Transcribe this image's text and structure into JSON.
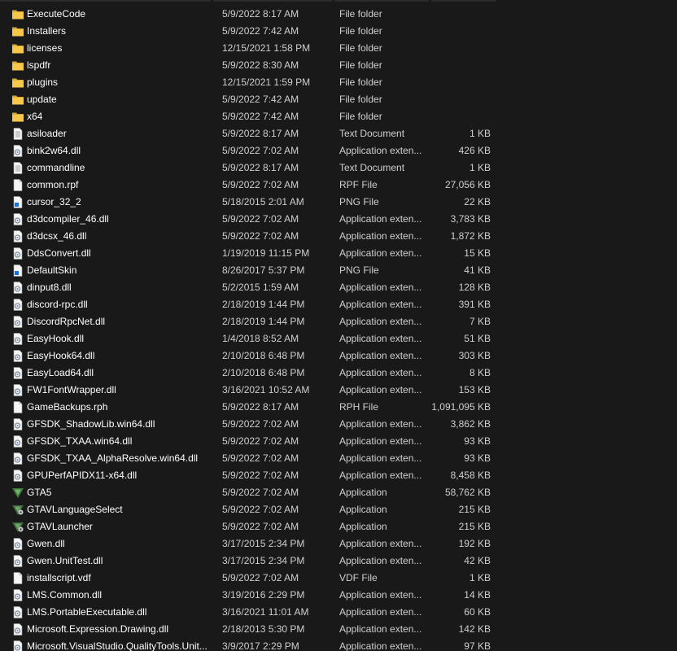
{
  "files": [
    {
      "name": "ExecuteCode",
      "date": "5/9/2022 8:17 AM",
      "type": "File folder",
      "size": "",
      "icon": "folder-icon"
    },
    {
      "name": "Installers",
      "date": "5/9/2022 7:42 AM",
      "type": "File folder",
      "size": "",
      "icon": "folder-icon"
    },
    {
      "name": "licenses",
      "date": "12/15/2021 1:58 PM",
      "type": "File folder",
      "size": "",
      "icon": "folder-icon"
    },
    {
      "name": "lspdfr",
      "date": "5/9/2022 8:30 AM",
      "type": "File folder",
      "size": "",
      "icon": "folder-icon"
    },
    {
      "name": "plugins",
      "date": "12/15/2021 1:59 PM",
      "type": "File folder",
      "size": "",
      "icon": "folder-icon"
    },
    {
      "name": "update",
      "date": "5/9/2022 7:42 AM",
      "type": "File folder",
      "size": "",
      "icon": "folder-icon"
    },
    {
      "name": "x64",
      "date": "5/9/2022 7:42 AM",
      "type": "File folder",
      "size": "",
      "icon": "folder-icon"
    },
    {
      "name": "asiloader",
      "date": "5/9/2022 8:17 AM",
      "type": "Text Document",
      "size": "1 KB",
      "icon": "text-document-icon"
    },
    {
      "name": "bink2w64.dll",
      "date": "5/9/2022 7:02 AM",
      "type": "Application exten...",
      "size": "426 KB",
      "icon": "dll-file-icon"
    },
    {
      "name": "commandline",
      "date": "5/9/2022 8:17 AM",
      "type": "Text Document",
      "size": "1 KB",
      "icon": "text-document-icon"
    },
    {
      "name": "common.rpf",
      "date": "5/9/2022 7:02 AM",
      "type": "RPF File",
      "size": "27,056 KB",
      "icon": "blank-file-icon"
    },
    {
      "name": "cursor_32_2",
      "date": "5/18/2015 2:01 AM",
      "type": "PNG File",
      "size": "22 KB",
      "icon": "png-file-icon"
    },
    {
      "name": "d3dcompiler_46.dll",
      "date": "5/9/2022 7:02 AM",
      "type": "Application exten...",
      "size": "3,783 KB",
      "icon": "dll-file-icon"
    },
    {
      "name": "d3dcsx_46.dll",
      "date": "5/9/2022 7:02 AM",
      "type": "Application exten...",
      "size": "1,872 KB",
      "icon": "dll-file-icon"
    },
    {
      "name": "DdsConvert.dll",
      "date": "1/19/2019 11:15 PM",
      "type": "Application exten...",
      "size": "15 KB",
      "icon": "dll-file-icon"
    },
    {
      "name": "DefaultSkin",
      "date": "8/26/2017 5:37 PM",
      "type": "PNG File",
      "size": "41 KB",
      "icon": "png-file-icon"
    },
    {
      "name": "dinput8.dll",
      "date": "5/2/2015 1:59 AM",
      "type": "Application exten...",
      "size": "128 KB",
      "icon": "dll-file-icon"
    },
    {
      "name": "discord-rpc.dll",
      "date": "2/18/2019 1:44 PM",
      "type": "Application exten...",
      "size": "391 KB",
      "icon": "dll-file-icon"
    },
    {
      "name": "DiscordRpcNet.dll",
      "date": "2/18/2019 1:44 PM",
      "type": "Application exten...",
      "size": "7 KB",
      "icon": "dll-file-icon"
    },
    {
      "name": "EasyHook.dll",
      "date": "1/4/2018 8:52 AM",
      "type": "Application exten...",
      "size": "51 KB",
      "icon": "dll-file-icon"
    },
    {
      "name": "EasyHook64.dll",
      "date": "2/10/2018 6:48 PM",
      "type": "Application exten...",
      "size": "303 KB",
      "icon": "dll-file-icon"
    },
    {
      "name": "EasyLoad64.dll",
      "date": "2/10/2018 6:48 PM",
      "type": "Application exten...",
      "size": "8 KB",
      "icon": "dll-file-icon"
    },
    {
      "name": "FW1FontWrapper.dll",
      "date": "3/16/2021 10:52 AM",
      "type": "Application exten...",
      "size": "153 KB",
      "icon": "dll-file-icon"
    },
    {
      "name": "GameBackups.rph",
      "date": "5/9/2022 8:17 AM",
      "type": "RPH File",
      "size": "1,091,095 KB",
      "icon": "blank-file-icon"
    },
    {
      "name": "GFSDK_ShadowLib.win64.dll",
      "date": "5/9/2022 7:02 AM",
      "type": "Application exten...",
      "size": "3,862 KB",
      "icon": "dll-file-icon"
    },
    {
      "name": "GFSDK_TXAA.win64.dll",
      "date": "5/9/2022 7:02 AM",
      "type": "Application exten...",
      "size": "93 KB",
      "icon": "dll-file-icon"
    },
    {
      "name": "GFSDK_TXAA_AlphaResolve.win64.dll",
      "date": "5/9/2022 7:02 AM",
      "type": "Application exten...",
      "size": "93 KB",
      "icon": "dll-file-icon"
    },
    {
      "name": "GPUPerfAPIDX11-x64.dll",
      "date": "5/9/2022 7:02 AM",
      "type": "Application exten...",
      "size": "8,458 KB",
      "icon": "dll-file-icon"
    },
    {
      "name": "GTA5",
      "date": "5/9/2022 7:02 AM",
      "type": "Application",
      "size": "58,762 KB",
      "icon": "gta-app-icon"
    },
    {
      "name": "GTAVLanguageSelect",
      "date": "5/9/2022 7:02 AM",
      "type": "Application",
      "size": "215 KB",
      "icon": "gta-gear-app-icon"
    },
    {
      "name": "GTAVLauncher",
      "date": "5/9/2022 7:02 AM",
      "type": "Application",
      "size": "215 KB",
      "icon": "gta-gear-app-icon"
    },
    {
      "name": "Gwen.dll",
      "date": "3/17/2015 2:34 PM",
      "type": "Application exten...",
      "size": "192 KB",
      "icon": "dll-file-icon"
    },
    {
      "name": "Gwen.UnitTest.dll",
      "date": "3/17/2015 2:34 PM",
      "type": "Application exten...",
      "size": "42 KB",
      "icon": "dll-file-icon"
    },
    {
      "name": "installscript.vdf",
      "date": "5/9/2022 7:02 AM",
      "type": "VDF File",
      "size": "1 KB",
      "icon": "blank-file-icon"
    },
    {
      "name": "LMS.Common.dll",
      "date": "3/19/2016 2:29 PM",
      "type": "Application exten...",
      "size": "14 KB",
      "icon": "dll-file-icon"
    },
    {
      "name": "LMS.PortableExecutable.dll",
      "date": "3/16/2021 11:01 AM",
      "type": "Application exten...",
      "size": "60 KB",
      "icon": "dll-file-icon"
    },
    {
      "name": "Microsoft.Expression.Drawing.dll",
      "date": "2/18/2013 5:30 PM",
      "type": "Application exten...",
      "size": "142 KB",
      "icon": "dll-file-icon"
    },
    {
      "name": "Microsoft.VisualStudio.QualityTools.Unit...",
      "date": "3/9/2017 2:29 PM",
      "type": "Application exten...",
      "size": "97 KB",
      "icon": "dll-file-icon"
    }
  ],
  "colors": {
    "background": "#191919",
    "text": "#ffffff",
    "secondary_text": "#cfcfcf",
    "folder": "#f5c84c"
  }
}
